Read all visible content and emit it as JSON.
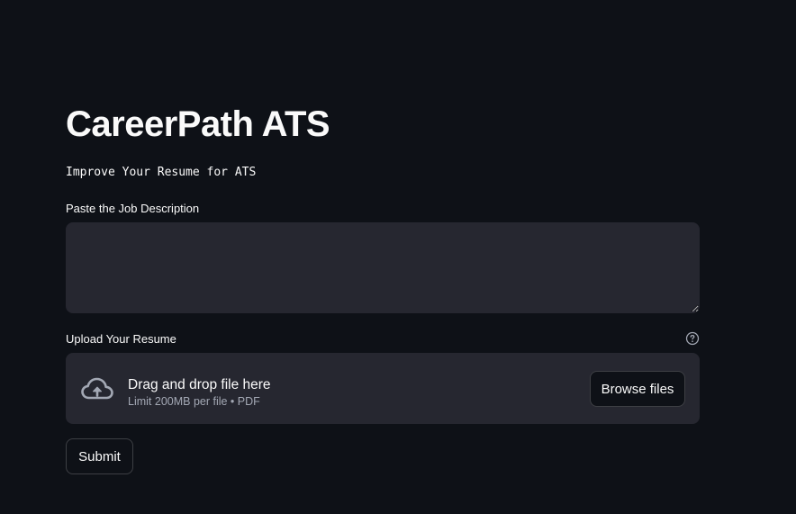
{
  "header": {
    "title": "CareerPath ATS",
    "subtitle": "Improve Your Resume for ATS"
  },
  "job_description": {
    "label": "Paste the Job Description",
    "value": "",
    "placeholder": ""
  },
  "resume_upload": {
    "label": "Upload Your Resume",
    "help_icon": "question-circle-icon",
    "dropzone_text": "Drag and drop file here",
    "limit_text": "Limit 200MB per file • PDF",
    "upload_icon": "cloud-upload-icon",
    "browse_label": "Browse files"
  },
  "actions": {
    "submit_label": "Submit"
  },
  "colors": {
    "background": "#0e1117",
    "surface": "#262730",
    "text": "#fafafa",
    "muted_text": "#a3a8b4"
  }
}
